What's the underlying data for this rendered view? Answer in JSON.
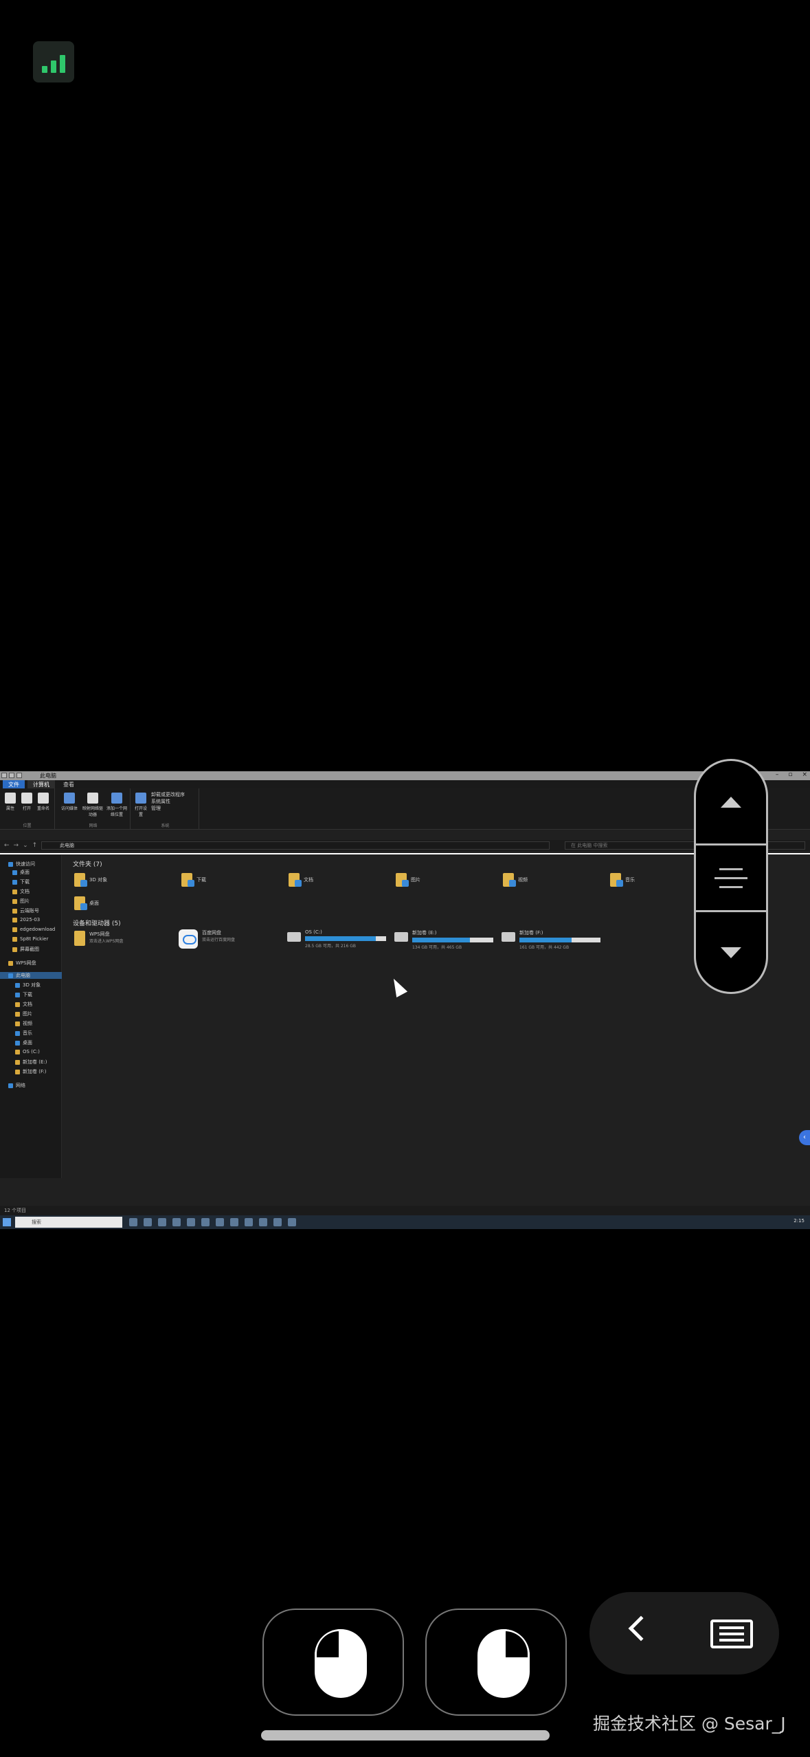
{
  "window": {
    "title": "此电脑",
    "tabs": [
      "文件",
      "计算机",
      "查看"
    ]
  },
  "ribbon": {
    "buttons": [
      "属性",
      "打开",
      "重命名",
      "访问媒体",
      "映射网络驱动器",
      "添加一个网络位置",
      "打开设置"
    ],
    "small_items": [
      "卸载或更改程序",
      "系统属性",
      "管理"
    ],
    "groups": [
      "位置",
      "网络",
      "系统"
    ]
  },
  "address": {
    "path": "此电脑",
    "search_placeholder": "在 此电脑 中搜索"
  },
  "sidebar": {
    "quick_access": "快速访问",
    "quick_items": [
      "桌面",
      "下载",
      "文档",
      "图片",
      "云端账号",
      "2025-03",
      "edgedownload",
      "Sp8t Pickier",
      "屏幕截图"
    ],
    "wps": "WPS网盘",
    "this_pc": "此电脑",
    "pc_items": [
      "3D 对象",
      "下载",
      "文档",
      "图片",
      "视频",
      "音乐",
      "桌面",
      "OS (C:)",
      "新加卷 (E:)",
      "新加卷 (F:)"
    ],
    "network": "网络"
  },
  "content": {
    "folders_heading": "文件夹 (7)",
    "folders": [
      "3D 对象",
      "下载",
      "文档",
      "图片",
      "视频",
      "音乐",
      "桌面"
    ],
    "devices_heading": "设备和驱动器 (5)",
    "devices": [
      {
        "name": "WPS网盘",
        "sub": "双击进入WPS网盘"
      },
      {
        "name": "百度网盘",
        "sub": "双击运行百度网盘"
      },
      {
        "name": "OS (C:)",
        "sub": "28.5 GB 可用，共 216 GB",
        "used": 0.87
      },
      {
        "name": "新加卷 (E:)",
        "sub": "134 GB 可用，共 465 GB",
        "used": 0.71
      },
      {
        "name": "新加卷 (F:)",
        "sub": "161 GB 可用，共 442 GB",
        "used": 0.64
      }
    ]
  },
  "status": {
    "items": "12 个项目"
  },
  "taskbar": {
    "search": "搜索",
    "time": "2:15"
  },
  "watermark": "掘金技术社区 @ Sesar_J",
  "colors": {
    "accent": "#2e8fd6",
    "signal": "#2fc76b"
  }
}
